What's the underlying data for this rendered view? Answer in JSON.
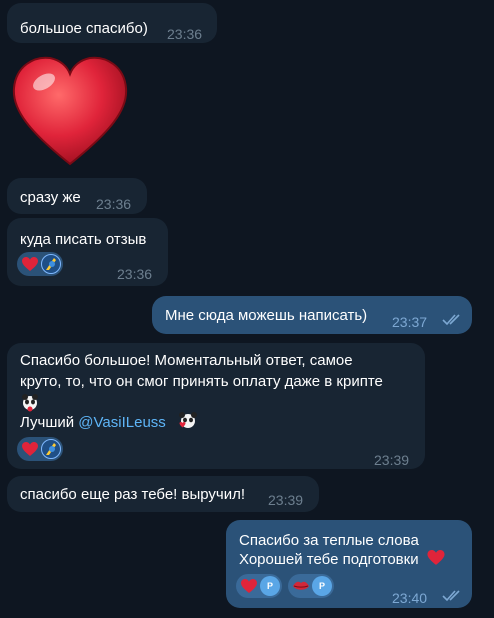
{
  "messages": [
    {
      "text": "большое спасибо)",
      "time": "23:36"
    },
    {
      "sticker": "red-heart"
    },
    {
      "text": "сразу же",
      "time": "23:36"
    },
    {
      "text": "куда писать отзыв",
      "time": "23:36",
      "reactions": [
        {
          "emoji": "heart",
          "user_icon": "avatar-icon"
        }
      ]
    },
    {
      "text": "Мне сюда можешь написать)",
      "time": "23:37",
      "status": "read"
    },
    {
      "lines": [
        "Спасибо большое! Моментальный ответ, самое",
        "круто, то, что он смог принять оплату даже в крипте"
      ],
      "line3_prefix": "Лучший ",
      "mention": "@VasiILeuss",
      "time": "23:39",
      "reactions": [
        {
          "emoji": "heart",
          "user_icon": "avatar-icon"
        }
      ]
    },
    {
      "text": "спасибо еще раз тебе! выручил!",
      "time": "23:39"
    },
    {
      "lines": [
        "Спасибо за теплые слова",
        "Хорошей тебе подготовки"
      ],
      "time": "23:40",
      "status": "read",
      "reactions": [
        {
          "emoji": "heart",
          "user_initial": "P"
        },
        {
          "emoji": "lips",
          "user_initial": "P"
        }
      ]
    }
  ],
  "colors": {
    "background": "#0e1621",
    "incoming_bubble": "#182533",
    "outgoing_bubble": "#2b5278",
    "link": "#5eb5f7",
    "heart": "#e0243a"
  }
}
